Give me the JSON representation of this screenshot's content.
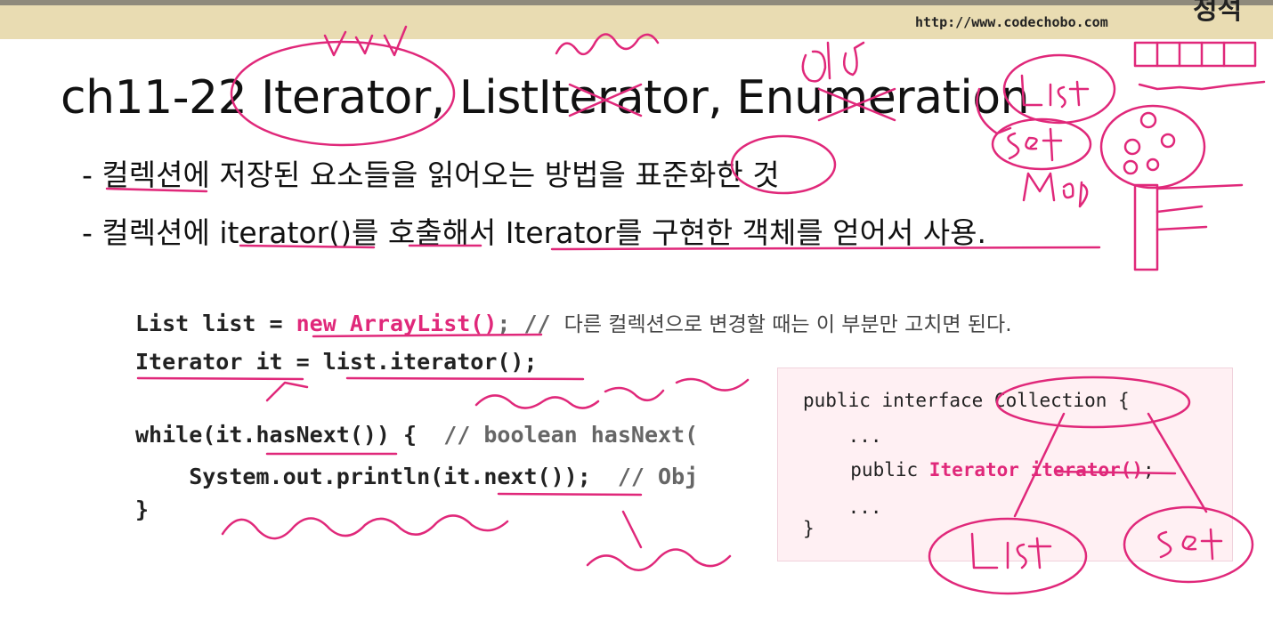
{
  "header": {
    "url": "http://www.codechobo.com",
    "corner_text": "정석"
  },
  "slide": {
    "title": "ch11-22 Iterator, ListIterator, Enumeration",
    "bullets": [
      {
        "prefix": "- 컬렉션에 저장된 요소들을 읽어오는 방법을 표준화한 것"
      },
      {
        "prefix": "- 컬렉션에 ",
        "mono": "iterator()",
        "suffix": "를 호출해서 ",
        "mid": "Iterator",
        "end": "를 구현한 객체를 얻어서 사용."
      }
    ]
  },
  "code": {
    "line1_a": "List list = ",
    "line1_kw": "new ArrayList()",
    "line1_b": "; // ",
    "line1_comment": "다른 컬렉션으로 변경할 때는 이 부분만 고치면 된다.",
    "line2": "Iterator it = list.iterator();",
    "line3_a": "while(it.hasNext()) {  ",
    "line3_comment": "// boolean hasNext(",
    "line4_a": "    System.out.println(it.next());  ",
    "line4_comment": "// Obj",
    "line5": "}"
  },
  "interface_box": {
    "line1": "public interface Collection {",
    "line2": "    ...",
    "line3_a": "  public ",
    "line3_kw1": "Iterator",
    "line3_b": " ",
    "line3_kw2": "iterator()",
    "line3_c": ";",
    "line4": "    ...",
    "line5": "}"
  },
  "colors": {
    "ink": "#e0287a",
    "keyword": "#e0287a",
    "header_bar": "#e9dcb2"
  }
}
